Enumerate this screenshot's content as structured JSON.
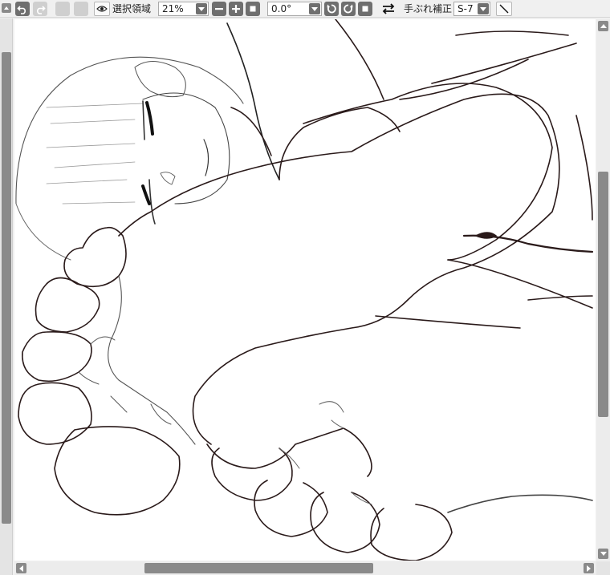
{
  "toolbar": {
    "undo_icon": "undo-icon",
    "redo_icon": "redo-icon",
    "select_area_icon": "eye-icon",
    "select_area_label": "選択領域",
    "zoom": {
      "value": "21%"
    },
    "rotation": {
      "value": "0.0°"
    },
    "flip_icon": "swap-arrows-icon",
    "stabilizer_label": "手ぶれ補正",
    "stabilizer": {
      "value": "S-7"
    },
    "line_tool_icon": "diagonal-line-icon"
  },
  "canvas": {
    "content": "line-art-illustration"
  },
  "colors": {
    "ui_background": "#f0f0f0",
    "button_gray": "#6f6f6f",
    "scrollbar_thumb": "#8a8a8a",
    "canvas": "#ffffff",
    "line_art": "#2a1a1a"
  }
}
